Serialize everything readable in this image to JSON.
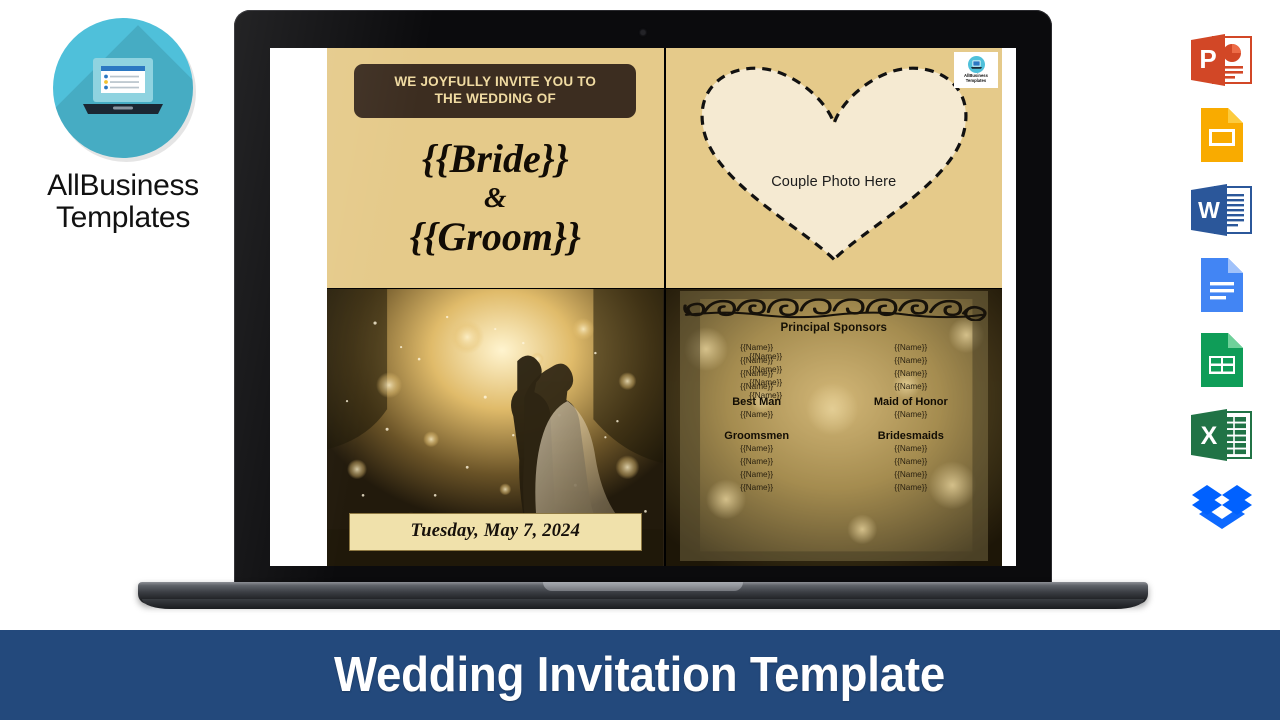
{
  "brand": {
    "name_line1": "AllBusiness",
    "name_line2": "Templates",
    "logo_icon": "laptop-circle-icon",
    "accent_color": "#4FC0DA"
  },
  "slide": {
    "invite": {
      "heading_line1": "WE JOYFULLY INVITE YOU TO",
      "heading_line2": "THE WEDDING OF",
      "bride": "{{Bride}}",
      "ampersand": "&",
      "groom": "{{Groom}}",
      "background_color": "#E5CA8A",
      "badge_color": "#3C2D20",
      "badge_text_color": "#F0DBA2"
    },
    "heart": {
      "placeholder_label": "Couple Photo Here",
      "fill_color": "#F5EAD2",
      "border_style": "dashed"
    },
    "photo": {
      "date": "Tuesday, May 7, 2024",
      "alt": "wedding couple silhouette in golden bokeh forest"
    },
    "sponsors": {
      "ornament_icon": "swirl-flourish-divider-icon",
      "title": "Principal Sponsors",
      "left_names": [
        "{{Name}}",
        "{{Name}}",
        "{{Name}}",
        "{{Name}}"
      ],
      "left_names_ghost": [
        "{{Name}}",
        "{{Name}}",
        "{{Name}}",
        "{{Name}}"
      ],
      "right_names": [
        "{{Name}}",
        "{{Name}}",
        "{{Name}}",
        "{{Name}}"
      ],
      "best_man_role": "Best Man",
      "best_man_name": "{{Name}}",
      "maid_of_honor_role": "Maid of Honor",
      "maid_of_honor_name": "{{Name}}",
      "groomsmen_role": "Groomsmen",
      "groomsmen_names": [
        "{{Name}}",
        "{{Name}}",
        "{{Name}}",
        "{{Name}}"
      ],
      "bridesmaids_role": "Bridesmaids",
      "bridesmaids_names": [
        "{{Name}}",
        "{{Name}}",
        "{{Name}}",
        "{{Name}}"
      ]
    },
    "watermark": {
      "line1": "AllBusiness",
      "line2": "Templates"
    }
  },
  "rail": {
    "items": [
      {
        "icon": "powerpoint-icon",
        "label": "Microsoft PowerPoint",
        "color": "#D24726"
      },
      {
        "icon": "google-slides-icon",
        "label": "Google Slides",
        "color": "#F9AB00"
      },
      {
        "icon": "word-icon",
        "label": "Microsoft Word",
        "color": "#2B579A"
      },
      {
        "icon": "google-docs-icon",
        "label": "Google Docs",
        "color": "#4285F4"
      },
      {
        "icon": "google-sheets-icon",
        "label": "Google Sheets",
        "color": "#0F9D58"
      },
      {
        "icon": "excel-icon",
        "label": "Microsoft Excel",
        "color": "#217346"
      },
      {
        "icon": "dropbox-icon",
        "label": "Dropbox",
        "color": "#0061FF"
      }
    ]
  },
  "banner": {
    "title": "Wedding Invitation Template",
    "background_color": "#23497C",
    "text_color": "#FFFFFF"
  }
}
